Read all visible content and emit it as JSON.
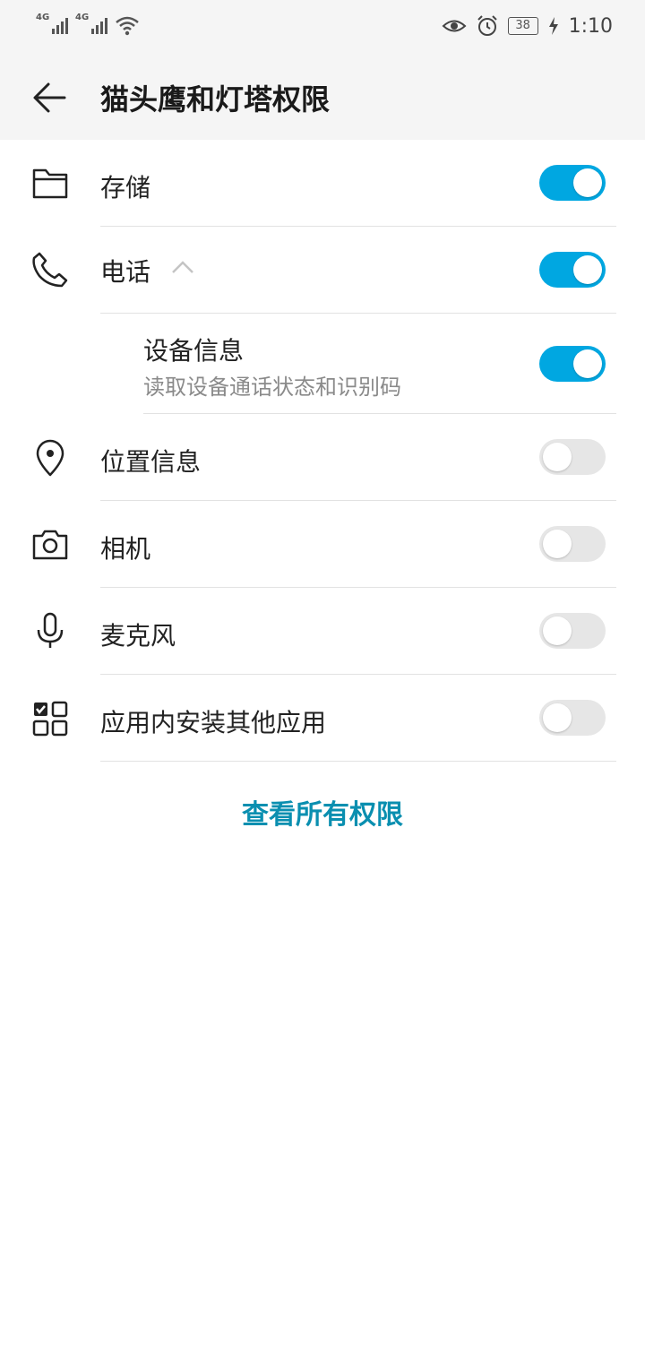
{
  "status_bar": {
    "signal1": "4G",
    "signal2": "4G",
    "battery": "38",
    "time": "1:10"
  },
  "header": {
    "title": "猫头鹰和灯塔权限"
  },
  "permissions": [
    {
      "label": "存储",
      "icon": "folder-icon",
      "enabled": true
    },
    {
      "label": "电话",
      "icon": "phone-icon",
      "enabled": true,
      "expanded": true,
      "children": [
        {
          "label": "设备信息",
          "description": "读取设备通话状态和识别码",
          "enabled": true
        }
      ]
    },
    {
      "label": "位置信息",
      "icon": "location-pin-icon",
      "enabled": false
    },
    {
      "label": "相机",
      "icon": "camera-icon",
      "enabled": false
    },
    {
      "label": "麦克风",
      "icon": "microphone-icon",
      "enabled": false
    },
    {
      "label": "应用内安装其他应用",
      "icon": "app-install-icon",
      "enabled": false
    }
  ],
  "footer": {
    "view_all": "查看所有权限"
  },
  "colors": {
    "accent": "#00a7e1",
    "link": "#0a8fb0",
    "toggle_off": "#e6e6e6"
  }
}
